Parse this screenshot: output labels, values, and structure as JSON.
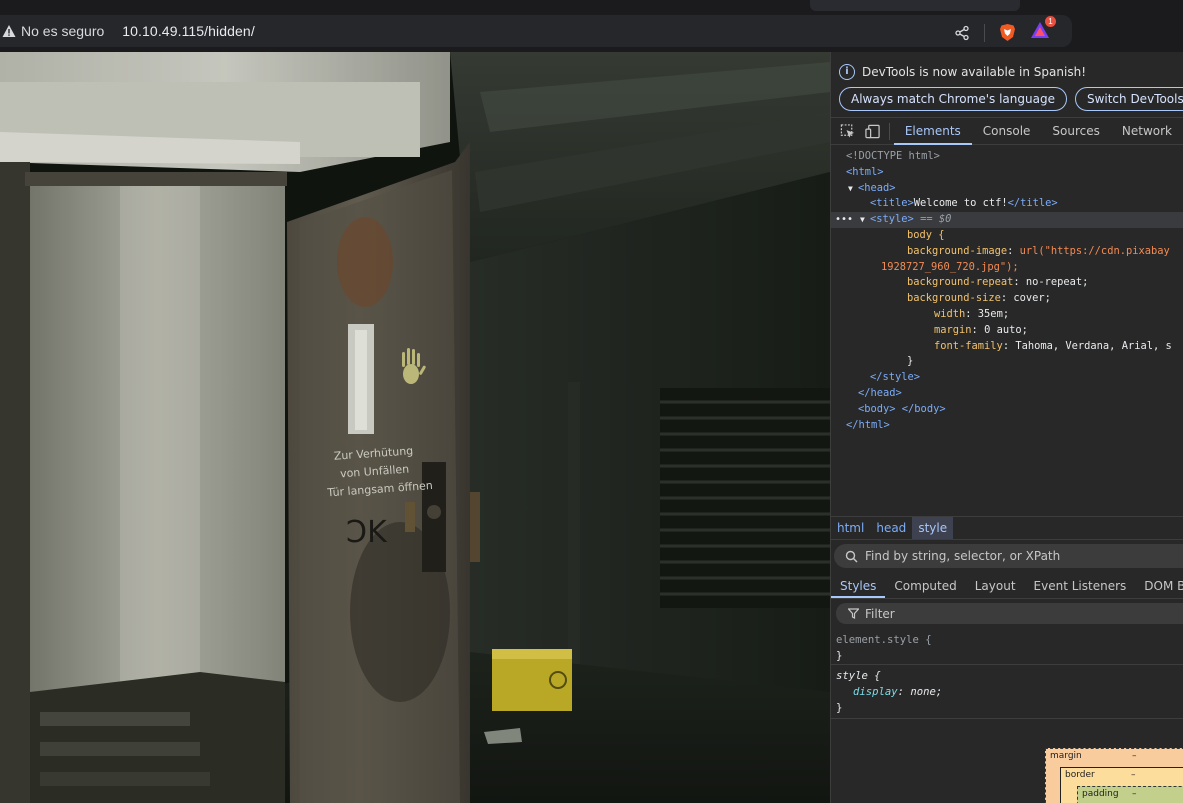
{
  "browser": {
    "security_label": "No es seguro",
    "url": "10.10.49.115/hidden/",
    "notification_count": "1"
  },
  "page": {
    "image_description": "Dark abandoned concrete corridor with an open weathered metal door bearing a painted hand print and German stencil text",
    "door_text": [
      "Zur Verhütung",
      "von Unfällen",
      "Tür langsam öffnen"
    ],
    "door_scrawl": "ƆK"
  },
  "devtools": {
    "info_message": "DevTools is now available in Spanish!",
    "info_buttons": [
      "Always match Chrome's language",
      "Switch DevTools to Sp"
    ],
    "tabs": [
      "Elements",
      "Console",
      "Sources",
      "Network"
    ],
    "active_tab": "Elements",
    "dom": {
      "doctype": "<!DOCTYPE html>",
      "html_open": "<html>",
      "head_open": "<head>",
      "title_open": "<title>",
      "title_text": "Welcome to ctf!",
      "title_close": "</title>",
      "style_open": "<style>",
      "style_marker": "== $0",
      "css_selector": "body {",
      "css_decls": [
        {
          "prop": "background-image",
          "value": "url(\"https://cdn.pixabay"
        },
        {
          "prop": "",
          "value": "1928727_960_720.jpg\");"
        },
        {
          "prop": "background-repeat",
          "value": "no-repeat;"
        },
        {
          "prop": "background-size",
          "value": "cover;"
        },
        {
          "prop": "width",
          "value": "35em;"
        },
        {
          "prop": "margin",
          "value": "0 auto;"
        },
        {
          "prop": "font-family",
          "value": "Tahoma, Verdana, Arial, s"
        }
      ],
      "css_close": "}",
      "style_close": "</style>",
      "head_close": "</head>",
      "body": "<body> </body>",
      "html_close": "</html>"
    },
    "breadcrumbs": [
      "html",
      "head",
      "style"
    ],
    "find_placeholder": "Find by string, selector, or XPath",
    "styles_tabs": [
      "Styles",
      "Computed",
      "Layout",
      "Event Listeners",
      "DOM Break"
    ],
    "filter_placeholder": "Filter",
    "rules": [
      {
        "selector": "element.style {",
        "decls": [],
        "close": "}"
      },
      {
        "selector": "style {",
        "decls": [
          {
            "prop": "display",
            "value": "none;"
          }
        ],
        "close": "}"
      }
    ],
    "box_model": {
      "margin": "margin",
      "border": "border",
      "padding": "padding",
      "dash": "–"
    }
  },
  "colors": {
    "accent": "#a8c7fa",
    "tag": "#7cacf8",
    "css_prop": "#f2c26b",
    "css_string": "#f28b54"
  }
}
